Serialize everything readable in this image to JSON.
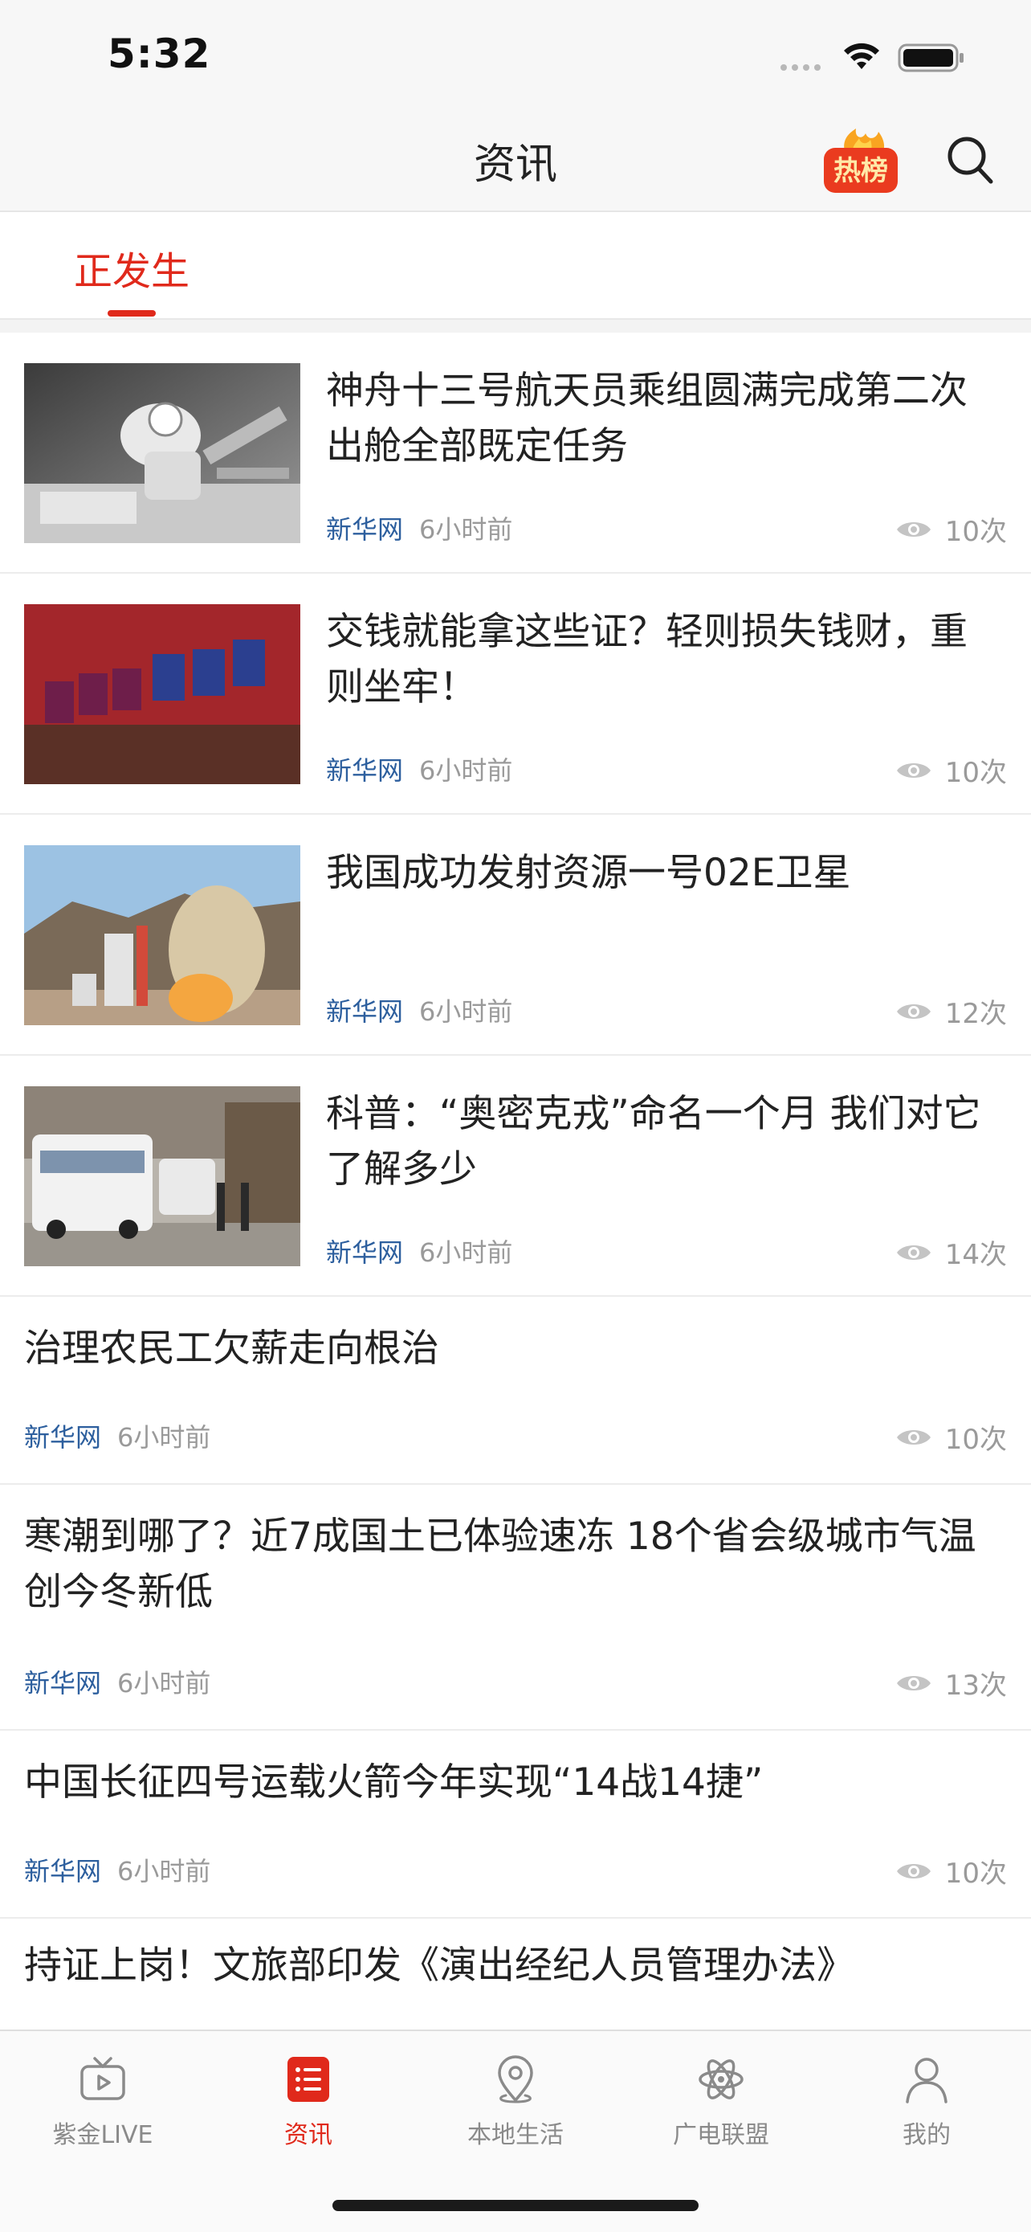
{
  "status_bar": {
    "time": "5:32"
  },
  "header": {
    "title": "资讯",
    "hot_badge_label": "热榜"
  },
  "tabs": {
    "active": "正发生"
  },
  "news": [
    {
      "title": "神舟十三号航天员乘组圆满完成第二次出舱全部既定任务",
      "source": "新华网",
      "time": "6小时前",
      "views": "10次"
    },
    {
      "title": "交钱就能拿这些证？轻则损失钱财，重则坐牢！",
      "source": "新华网",
      "time": "6小时前",
      "views": "10次"
    },
    {
      "title": "我国成功发射资源一号02E卫星",
      "source": "新华网",
      "time": "6小时前",
      "views": "12次"
    },
    {
      "title": "科普：“奥密克戎”命名一个月 我们对它了解多少",
      "source": "新华网",
      "time": "6小时前",
      "views": "14次"
    },
    {
      "title": "治理农民工欠薪走向根治",
      "source": "新华网",
      "time": "6小时前",
      "views": "10次"
    },
    {
      "title": "寒潮到哪了？近7成国土已体验速冻 18个省会级城市气温创今冬新低",
      "source": "新华网",
      "time": "6小时前",
      "views": "13次"
    },
    {
      "title": "中国长征四号运载火箭今年实现“14战14捷”",
      "source": "新华网",
      "time": "6小时前",
      "views": "10次"
    },
    {
      "title": "持证上岗！文旅部印发《演出经纪人员管理办法》"
    }
  ],
  "tabbar": {
    "items": [
      {
        "label": "紫金LIVE",
        "icon": "tv-icon"
      },
      {
        "label": "资讯",
        "icon": "list-icon"
      },
      {
        "label": "本地生活",
        "icon": "location-icon"
      },
      {
        "label": "广电联盟",
        "icon": "atom-icon"
      },
      {
        "label": "我的",
        "icon": "person-icon"
      }
    ],
    "active_index": 1
  },
  "colors": {
    "accent": "#e0291b",
    "source_blue": "#2d5f9e",
    "meta_gray": "#9a9a9a"
  }
}
